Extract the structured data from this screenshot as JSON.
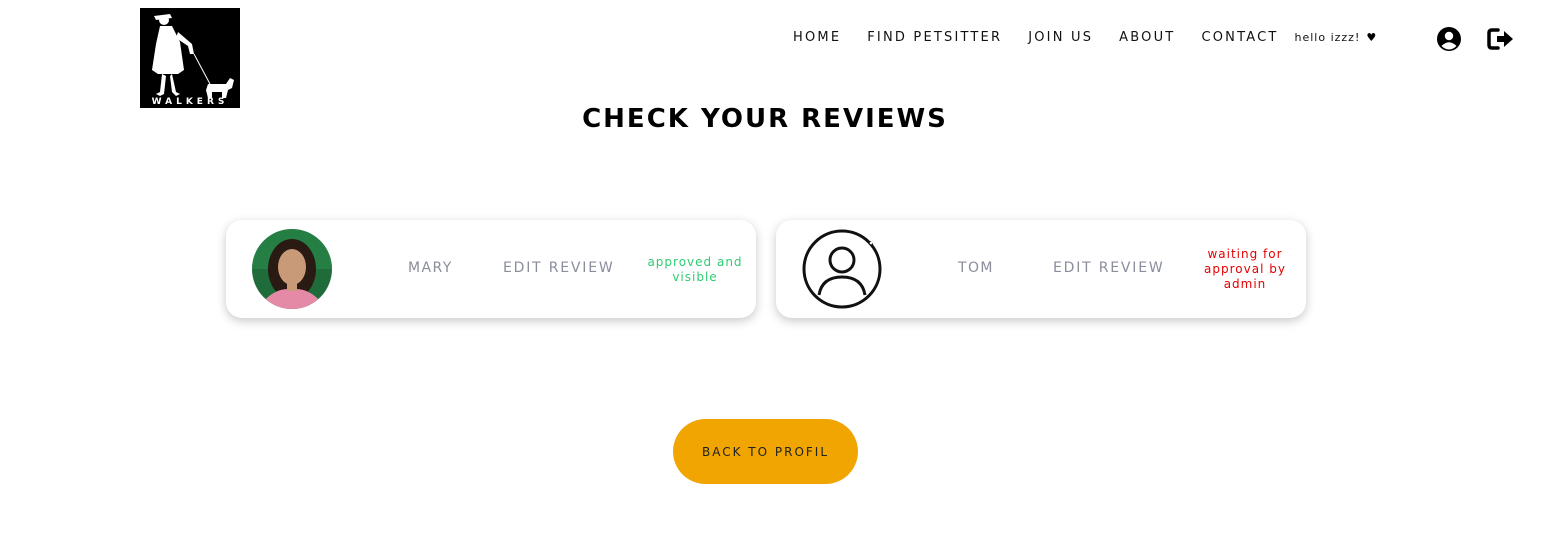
{
  "brand": {
    "logo_text": "WALKERS"
  },
  "nav": {
    "items": [
      "HOME",
      "FIND PETSITTER",
      "JOIN US",
      "ABOUT",
      "CONTACT"
    ],
    "greeting": "hello izzz!",
    "heart": "♥",
    "icons": [
      "user-circle-icon",
      "logout-icon"
    ]
  },
  "page": {
    "title": "CHECK YOUR REVIEWS"
  },
  "reviews": [
    {
      "name": "MARY",
      "action": "EDIT REVIEW",
      "status": "approved and visible",
      "status_color": "#2ecc71"
    },
    {
      "name": "TOM",
      "action": "EDIT REVIEW",
      "status": "waiting for approval by admin",
      "status_color": "#e60000"
    }
  ],
  "back_button": {
    "label": "BACK TO PROFIL",
    "color": "#f0a500"
  }
}
